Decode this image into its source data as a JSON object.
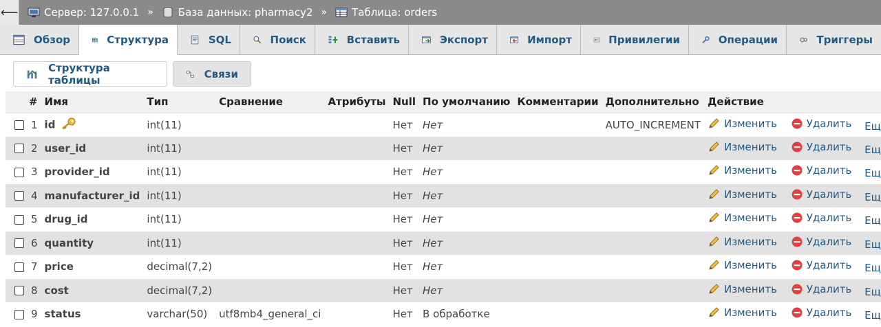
{
  "breadcrumb": {
    "back_symbol": "⟵",
    "items": [
      "Сервер: 127.0.0.1",
      "База данных: pharmacy2",
      "Таблица: orders"
    ],
    "separator": "»"
  },
  "tabs": [
    {
      "label": "Обзор",
      "icon": "browse-icon"
    },
    {
      "label": "Структура",
      "icon": "structure-icon",
      "active": true
    },
    {
      "label": "SQL",
      "icon": "sql-icon"
    },
    {
      "label": "Поиск",
      "icon": "search-icon"
    },
    {
      "label": "Вставить",
      "icon": "insert-icon"
    },
    {
      "label": "Экспорт",
      "icon": "export-icon"
    },
    {
      "label": "Импорт",
      "icon": "import-icon"
    },
    {
      "label": "Привилегии",
      "icon": "privileges-icon"
    },
    {
      "label": "Операции",
      "icon": "operations-icon"
    },
    {
      "label": "Триггеры",
      "icon": "triggers-icon"
    }
  ],
  "subbuttons": {
    "structure": "Структура таблицы",
    "relations": "Связи"
  },
  "table": {
    "headers": [
      "#",
      "Имя",
      "Тип",
      "Сравнение",
      "Атрибуты",
      "Null",
      "По умолчанию",
      "Комментарии",
      "Дополнительно",
      "Действие"
    ],
    "actions": {
      "edit": "Изменить",
      "delete": "Удалить",
      "more": "Ещё"
    },
    "rows": [
      {
        "num": "1",
        "name": "id",
        "type": "int(11)",
        "collation": "",
        "null": "Нет",
        "default": "Нет",
        "extra": "AUTO_INCREMENT",
        "primary": true
      },
      {
        "num": "2",
        "name": "user_id",
        "type": "int(11)",
        "collation": "",
        "null": "Нет",
        "default": "Нет",
        "extra": ""
      },
      {
        "num": "3",
        "name": "provider_id",
        "type": "int(11)",
        "collation": "",
        "null": "Нет",
        "default": "Нет",
        "extra": ""
      },
      {
        "num": "4",
        "name": "manufacturer_id",
        "type": "int(11)",
        "collation": "",
        "null": "Нет",
        "default": "Нет",
        "extra": ""
      },
      {
        "num": "5",
        "name": "drug_id",
        "type": "int(11)",
        "collation": "",
        "null": "Нет",
        "default": "Нет",
        "extra": ""
      },
      {
        "num": "6",
        "name": "quantity",
        "type": "int(11)",
        "collation": "",
        "null": "Нет",
        "default": "Нет",
        "extra": ""
      },
      {
        "num": "7",
        "name": "price",
        "type": "decimal(7,2)",
        "collation": "",
        "null": "Нет",
        "default": "Нет",
        "extra": ""
      },
      {
        "num": "8",
        "name": "cost",
        "type": "decimal(7,2)",
        "collation": "",
        "null": "Нет",
        "default": "Нет",
        "extra": ""
      },
      {
        "num": "9",
        "name": "status",
        "type": "varchar(50)",
        "collation": "utf8mb4_general_ci",
        "null": "Нет",
        "default": "В обработке",
        "default_plain": true,
        "extra": ""
      }
    ]
  }
}
